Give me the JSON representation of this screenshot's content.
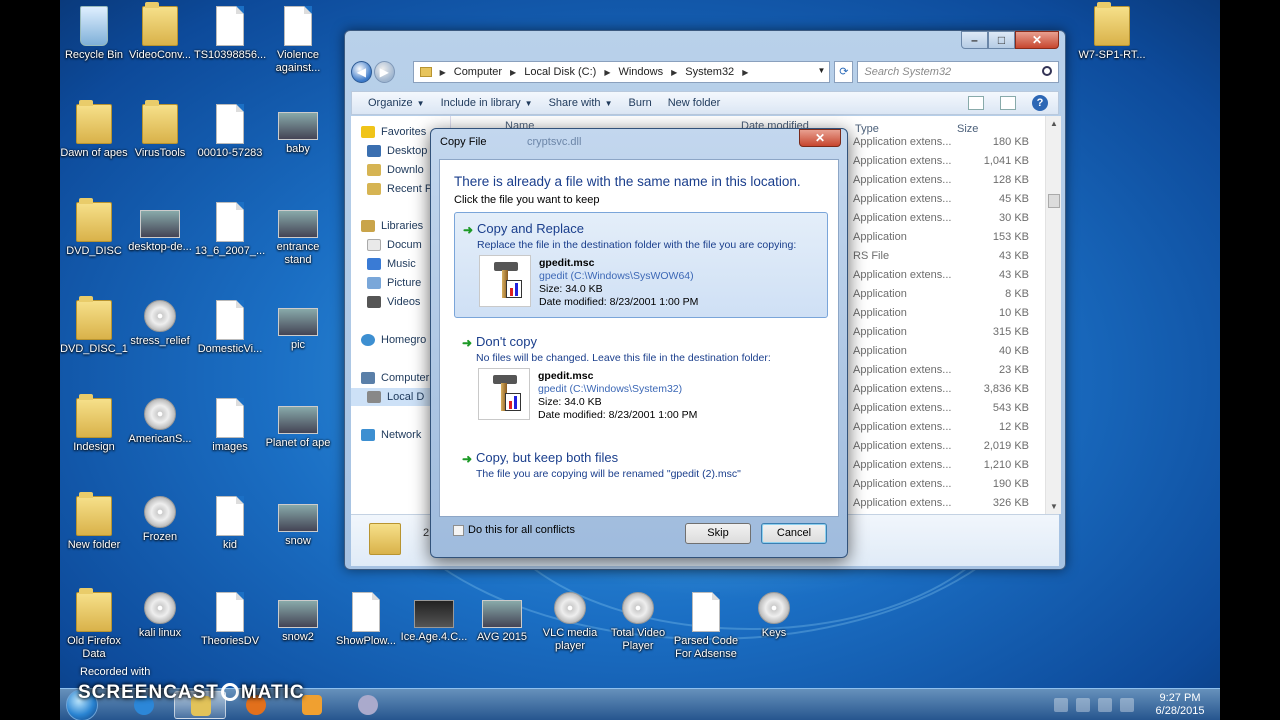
{
  "desktop_icons": [
    {
      "label": "Recycle Bin",
      "icon": "recycle-bin-icon"
    },
    {
      "label": "VideoConv...",
      "icon": "folder-icon"
    },
    {
      "label": "TS10398856...",
      "icon": "document-icon"
    },
    {
      "label": "Violence against...",
      "icon": "document-icon"
    },
    {
      "label": "Dawn of apes",
      "icon": "folder-icon"
    },
    {
      "label": "VirusTools",
      "icon": "folder-icon"
    },
    {
      "label": "00010-57283",
      "icon": "document-icon"
    },
    {
      "label": "baby",
      "icon": "photo-icon"
    },
    {
      "label": "DVD_DISC",
      "icon": "folder-icon"
    },
    {
      "label": "desktop-de...",
      "icon": "desktop-app-icon"
    },
    {
      "label": "13_6_2007_...",
      "icon": "document-icon"
    },
    {
      "label": "entrance stand",
      "icon": "photo-icon"
    },
    {
      "label": "DVD_DISC_1",
      "icon": "folder-icon"
    },
    {
      "label": "stress_relief",
      "icon": "app-icon"
    },
    {
      "label": "DomesticVi...",
      "icon": "document-icon"
    },
    {
      "label": "pic",
      "icon": "photo-icon"
    },
    {
      "label": "Indesign",
      "icon": "folder-icon"
    },
    {
      "label": "AmericanS...",
      "icon": "disc-icon"
    },
    {
      "label": "images",
      "icon": "document-icon"
    },
    {
      "label": "Planet of ape",
      "icon": "photo-icon"
    },
    {
      "label": "New folder",
      "icon": "folder-icon"
    },
    {
      "label": "Frozen",
      "icon": "disc-icon"
    },
    {
      "label": "kid",
      "icon": "document-icon"
    },
    {
      "label": "snow",
      "icon": "photo-icon"
    },
    {
      "label": "Old Firefox Data",
      "icon": "folder-icon"
    },
    {
      "label": "kali linux",
      "icon": "disc-icon"
    },
    {
      "label": "TheoriesDV",
      "icon": "document-icon"
    },
    {
      "label": "snow2",
      "icon": "photo-icon"
    },
    {
      "label": "ShowPlow...",
      "icon": "word-doc-icon"
    },
    {
      "label": "Ice.Age.4.C...",
      "icon": "video-icon"
    },
    {
      "label": "AVG 2015",
      "icon": "avg-icon"
    },
    {
      "label": "VLC media player",
      "icon": "vlc-icon"
    },
    {
      "label": "Total Video Player",
      "icon": "video-player-icon"
    },
    {
      "label": "Parsed Code For Adsense",
      "icon": "document-icon"
    },
    {
      "label": "Keys",
      "icon": "keys-icon"
    },
    {
      "label": "W7-SP1-RT...",
      "icon": "folder-icon"
    }
  ],
  "explorer": {
    "breadcrumb": [
      "Computer",
      "Local Disk (C:)",
      "Windows",
      "System32"
    ],
    "search_placeholder": "Search System32",
    "toolbar": {
      "organize": "Organize",
      "include_in_library": "Include in library",
      "share_with": "Share with",
      "burn": "Burn",
      "new_folder": "New folder"
    },
    "nav": {
      "favorites": "Favorites",
      "desktop": "Desktop",
      "downloads": "Downlo",
      "recent": "Recent P",
      "libraries": "Libraries",
      "documents": "Docum",
      "music": "Music",
      "pictures": "Picture",
      "videos": "Videos",
      "homegroup": "Homegro",
      "computer": "Computer",
      "local_disk": "Local D",
      "network": "Network"
    },
    "columns": {
      "name": "Name",
      "date_modified": "Date modified",
      "type": "Type",
      "size": "Size"
    },
    "rows": [
      {
        "type": "Application extens...",
        "size": "180 KB"
      },
      {
        "type": "Application extens...",
        "size": "1,041 KB"
      },
      {
        "type": "Application extens...",
        "size": "128 KB"
      },
      {
        "type": "Application extens...",
        "size": "45 KB"
      },
      {
        "type": "Application extens...",
        "size": "30 KB"
      },
      {
        "type": "Application",
        "size": "153 KB"
      },
      {
        "type": "RS File",
        "size": "43 KB"
      },
      {
        "type": "Application extens...",
        "size": "43 KB"
      },
      {
        "type": "Application",
        "size": "8 KB"
      },
      {
        "type": "Application",
        "size": "10 KB"
      },
      {
        "type": "Application",
        "size": "315 KB"
      },
      {
        "type": "Application",
        "size": "40 KB"
      },
      {
        "type": "Application extens...",
        "size": "23 KB"
      },
      {
        "type": "Application extens...",
        "size": "3,836 KB"
      },
      {
        "type": "Application extens...",
        "size": "543 KB"
      },
      {
        "type": "Application extens...",
        "size": "12 KB"
      },
      {
        "type": "Application extens...",
        "size": "2,019 KB"
      },
      {
        "type": "Application extens...",
        "size": "1,210 KB"
      },
      {
        "type": "Application extens...",
        "size": "190 KB"
      },
      {
        "type": "Application extens...",
        "size": "326 KB"
      }
    ],
    "details_count": "2,"
  },
  "dialog": {
    "title": "Copy File",
    "ghost_file": "cryptsvc.dll",
    "heading": "There is already a file with the same name in this location.",
    "subheading": "Click the file you want to keep",
    "options": [
      {
        "title": "Copy and Replace",
        "desc": "Replace the file in the destination folder with the file you are copying:",
        "file_name": "gpedit.msc",
        "file_path": "gpedit (C:\\Windows\\SysWOW64)",
        "file_size": "Size: 34.0 KB",
        "file_date": "Date modified: 8/23/2001 1:00 PM"
      },
      {
        "title": "Don't copy",
        "desc": "No files will be changed. Leave this file in the destination folder:",
        "file_name": "gpedit.msc",
        "file_path": "gpedit (C:\\Windows\\System32)",
        "file_size": "Size: 34.0 KB",
        "file_date": "Date modified: 8/23/2001 1:00 PM"
      },
      {
        "title": "Copy, but keep both files",
        "desc": "The file you are copying will be renamed \"gpedit (2).msc\""
      }
    ],
    "checkbox_label": "Do this for all conflicts",
    "skip_label": "Skip",
    "cancel_label": "Cancel"
  },
  "taskbar": {
    "time": "9:27 PM",
    "date": "6/28/2015"
  },
  "watermark": {
    "recorded_with": "Recorded with",
    "brand_left": "SCREENCAST",
    "brand_right": "MATIC"
  }
}
